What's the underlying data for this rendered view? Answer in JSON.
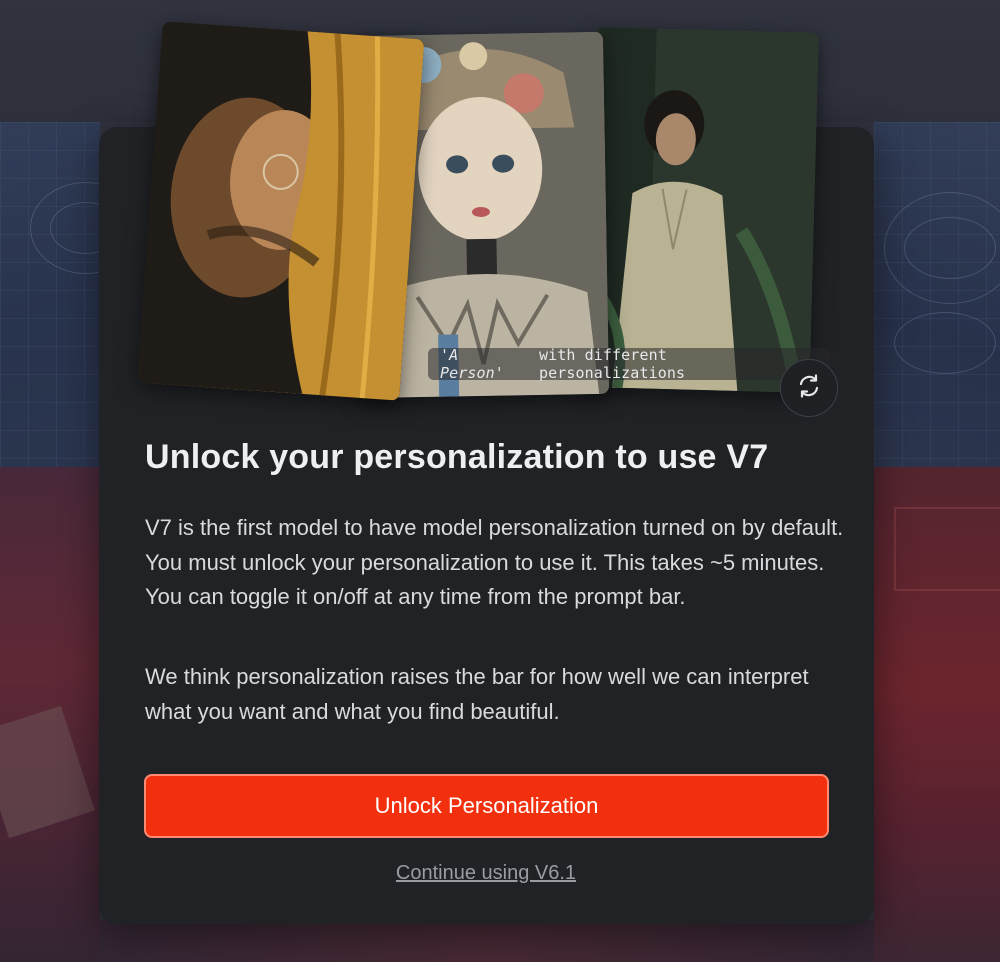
{
  "modal": {
    "image_caption_italic": "'A Person'",
    "image_caption_rest": "with different personalizations",
    "refresh_icon": "refresh-icon",
    "title": "Unlock your personalization to use V7",
    "paragraph_1": "V7 is the first model to have model personalization turned on by default. You must unlock your personalization to use it. This takes ~5 minutes. You can toggle it on/off at any time from the prompt bar.",
    "paragraph_2": "We think personalization raises the bar for how well we can interpret what you want and what you find beautiful.",
    "primary_button": "Unlock Personalization",
    "secondary_link": "Continue using V6.1"
  },
  "colors": {
    "modal_bg": "#202226",
    "primary_button": "#f2300d",
    "text": "#eeeff1",
    "link": "#9a9ca3"
  }
}
